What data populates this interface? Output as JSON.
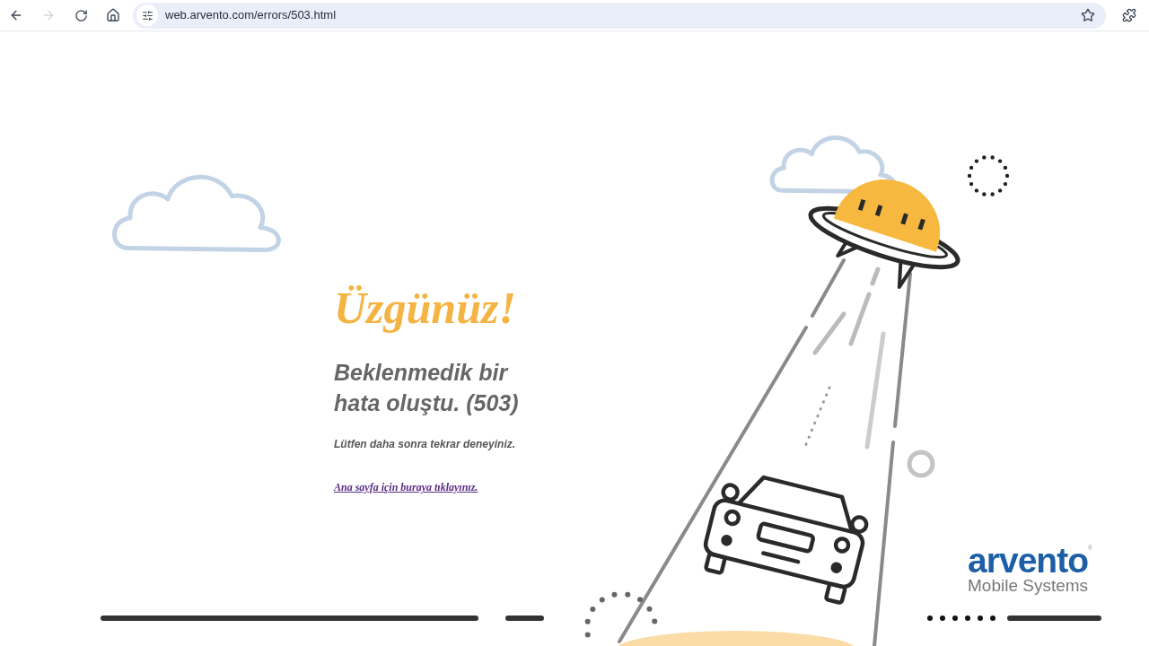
{
  "browser": {
    "url": "web.arvento.com/errors/503.html",
    "forward_disabled": true
  },
  "message": {
    "title": "Üzgünüz!",
    "heading": "Beklenmedik bir hata oluştu. (503)",
    "body": "Lütfen daha sonra tekrar deneyiniz.",
    "link": "Ana sayfa için buraya tıklayınız."
  },
  "logo": {
    "name": "arvento",
    "mark": "®",
    "tagline": "Mobile Systems"
  }
}
